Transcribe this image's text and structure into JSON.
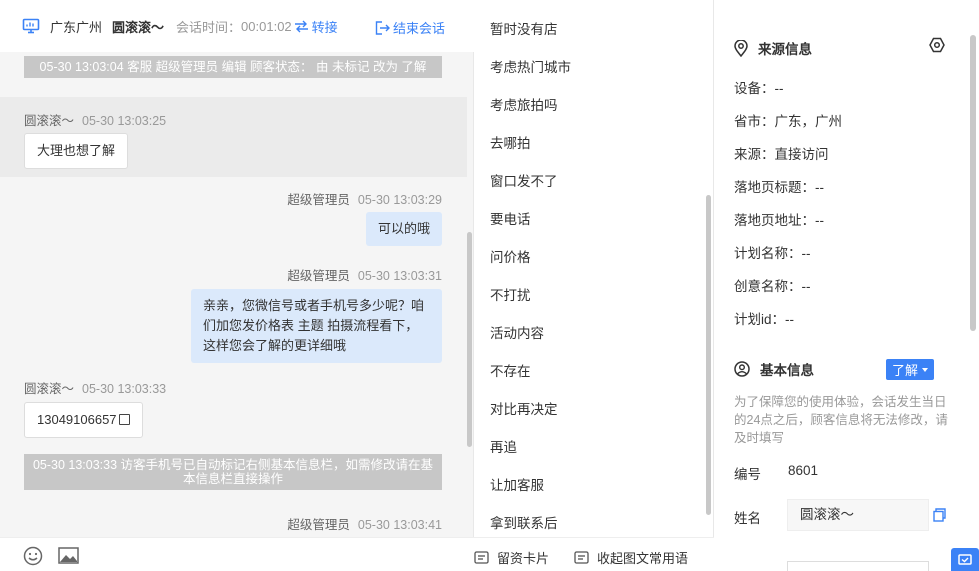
{
  "header": {
    "location": "广东广州",
    "visitor_name": "圆滚滚～",
    "session_time_label": "会话时间：",
    "session_time": "00:01:02",
    "transfer_label": "转接",
    "end_label": "结束会话"
  },
  "messages": {
    "sys1": "05-30 13:03:04 客服 超级管理员 编辑 顾客状态： 由 未标记 改为 了解",
    "in1": {
      "sender": "圆滚滚～",
      "time": "05-30 13:03:25",
      "text": "大理也想了解"
    },
    "out1": {
      "sender": "超级管理员",
      "time": "05-30 13:03:29",
      "text": "可以的哦"
    },
    "out2": {
      "sender": "超级管理员",
      "time": "05-30 13:03:31",
      "text": "亲亲，您微信号或者手机号多少呢？咱们加您发价格表 主题 拍摄流程看下，这样您会了解的更详细哦"
    },
    "in2": {
      "sender": "圆滚滚～",
      "time": "05-30 13:03:33",
      "text": "13049106657"
    },
    "sys2": "05-30 13:03:33 访客手机号已自动标记右侧基本信息栏，如需修改请在基本信息栏直接操作",
    "out3": {
      "sender": "超级管理员",
      "time": "05-30 13:03:41"
    }
  },
  "phrases": {
    "items": [
      "暂时没有店",
      "考虑热门城市",
      "考虑旅拍吗",
      "去哪拍",
      "窗口发不了",
      "要电话",
      "问价格",
      "不打扰",
      "活动内容",
      "不存在",
      "对比再决定",
      "再追",
      "让加客服",
      "拿到联系后"
    ],
    "footer_card": "留资卡片",
    "footer_collapse": "收起图文常用语"
  },
  "source_info": {
    "title": "来源信息",
    "device": "设备：--",
    "province_city": "省市：广东，广州",
    "source": "来源：直接访问",
    "landing_title": "落地页标题：--",
    "landing_url": "落地页地址：--",
    "plan_name": "计划名称：--",
    "creative_name": "创意名称：--",
    "plan_id": "计划id：--"
  },
  "basic_info": {
    "title": "基本信息",
    "status_button": "了解",
    "notice": "为了保障您的使用体验，会话发生当日的24点之后，顾客信息将无法修改，请及时填写",
    "id_label": "编号",
    "id_value": "8601",
    "name_label": "姓名",
    "name_value": "圆滚滚～"
  },
  "colors": {
    "accent": "#3b82f6",
    "outgoing_bubble": "#dbe9fb",
    "system_notice": "#c7c7c7"
  }
}
